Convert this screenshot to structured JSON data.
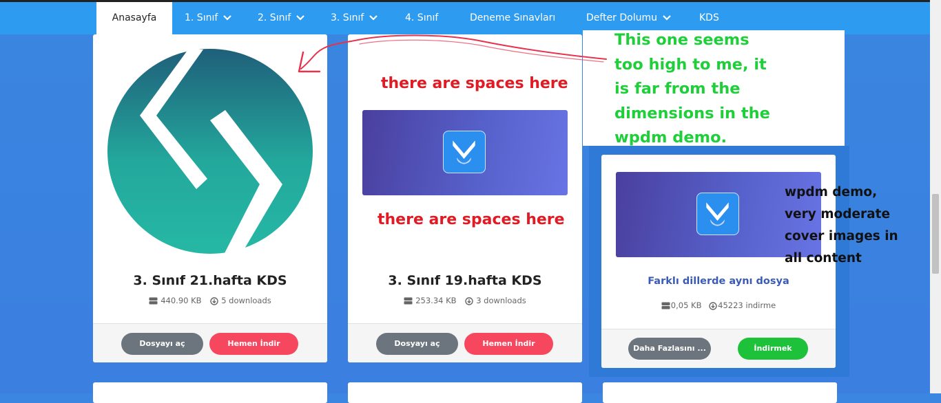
{
  "nav": {
    "items": [
      {
        "label": "Anasayfa",
        "active": true,
        "dropdown": false
      },
      {
        "label": "1. Sınıf",
        "dropdown": true
      },
      {
        "label": "2. Sınıf",
        "dropdown": true
      },
      {
        "label": "3. Sınıf",
        "dropdown": true
      },
      {
        "label": "4. Sınıf",
        "dropdown": false
      },
      {
        "label": "Deneme Sınavları",
        "dropdown": false
      },
      {
        "label": "Defter Dolumu",
        "dropdown": true
      },
      {
        "label": "KDS",
        "dropdown": false
      }
    ]
  },
  "cards": [
    {
      "title": "3. Sınıf 21.hafta KDS",
      "size": "440.90 KB",
      "downloads": "5 downloads",
      "open_label": "Dosyayı aç",
      "download_label": "Hemen İndir",
      "image": "teal-logo-circle"
    },
    {
      "title": "3. Sınıf 19.hafta KDS",
      "size": "253.34 KB",
      "downloads": "3 downloads",
      "open_label": "Dosyayı aç",
      "download_label": "Hemen İndir",
      "image": "download-cover"
    },
    {
      "title": "Farklı dillerde aynı dosya",
      "size": "0,05 KB",
      "downloads": "45223 indirme",
      "open_label": "Daha Fazlasını ...",
      "download_label": "İndirmek",
      "image": "download-cover"
    }
  ],
  "annotations": {
    "spaces_top": "there are spaces here",
    "spaces_bottom": "there are spaces here",
    "too_high": [
      "This one seems",
      "too high to me, it",
      "is far from the",
      "dimensions in the",
      "wpdm demo."
    ],
    "demo_note": [
      "wpdm demo,",
      "very moderate",
      "cover images in",
      "all content"
    ]
  },
  "colors": {
    "nav_bg": "#2d9cf0",
    "page_bg": "#3a86e0",
    "red_button": "#f6475f",
    "green_button": "#1ec13a",
    "annotation_red": "#e01b24",
    "annotation_green": "#1fcf3a",
    "link_blue": "#3a5bb8"
  }
}
